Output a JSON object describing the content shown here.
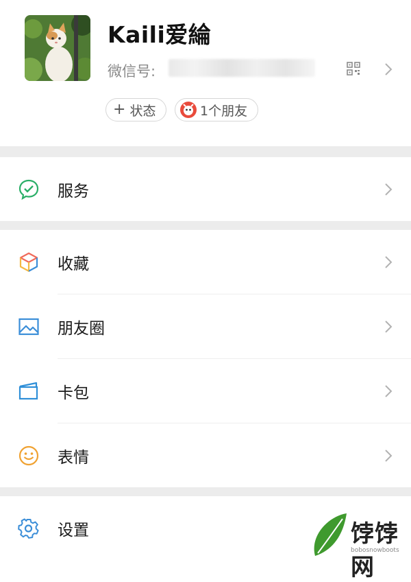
{
  "profile": {
    "nickname": "Kaili爱綸",
    "wechat_id_label": "微信号:",
    "status_button": "状态",
    "status_plus": "+",
    "friends_button": "1个朋友"
  },
  "menu": {
    "services": "服务",
    "favorites": "收藏",
    "moments": "朋友圈",
    "cards": "卡包",
    "stickers": "表情",
    "settings": "设置"
  },
  "watermark": {
    "text": "饽饽网",
    "sub": "bobosnowboots"
  },
  "colors": {
    "services_icon": "#2aae67",
    "moments_icon": "#3b8ed8",
    "cards_icon": "#2f8fd8",
    "stickers_icon": "#f0a232",
    "settings_icon": "#3b8ed8",
    "separator": "#ececec"
  }
}
